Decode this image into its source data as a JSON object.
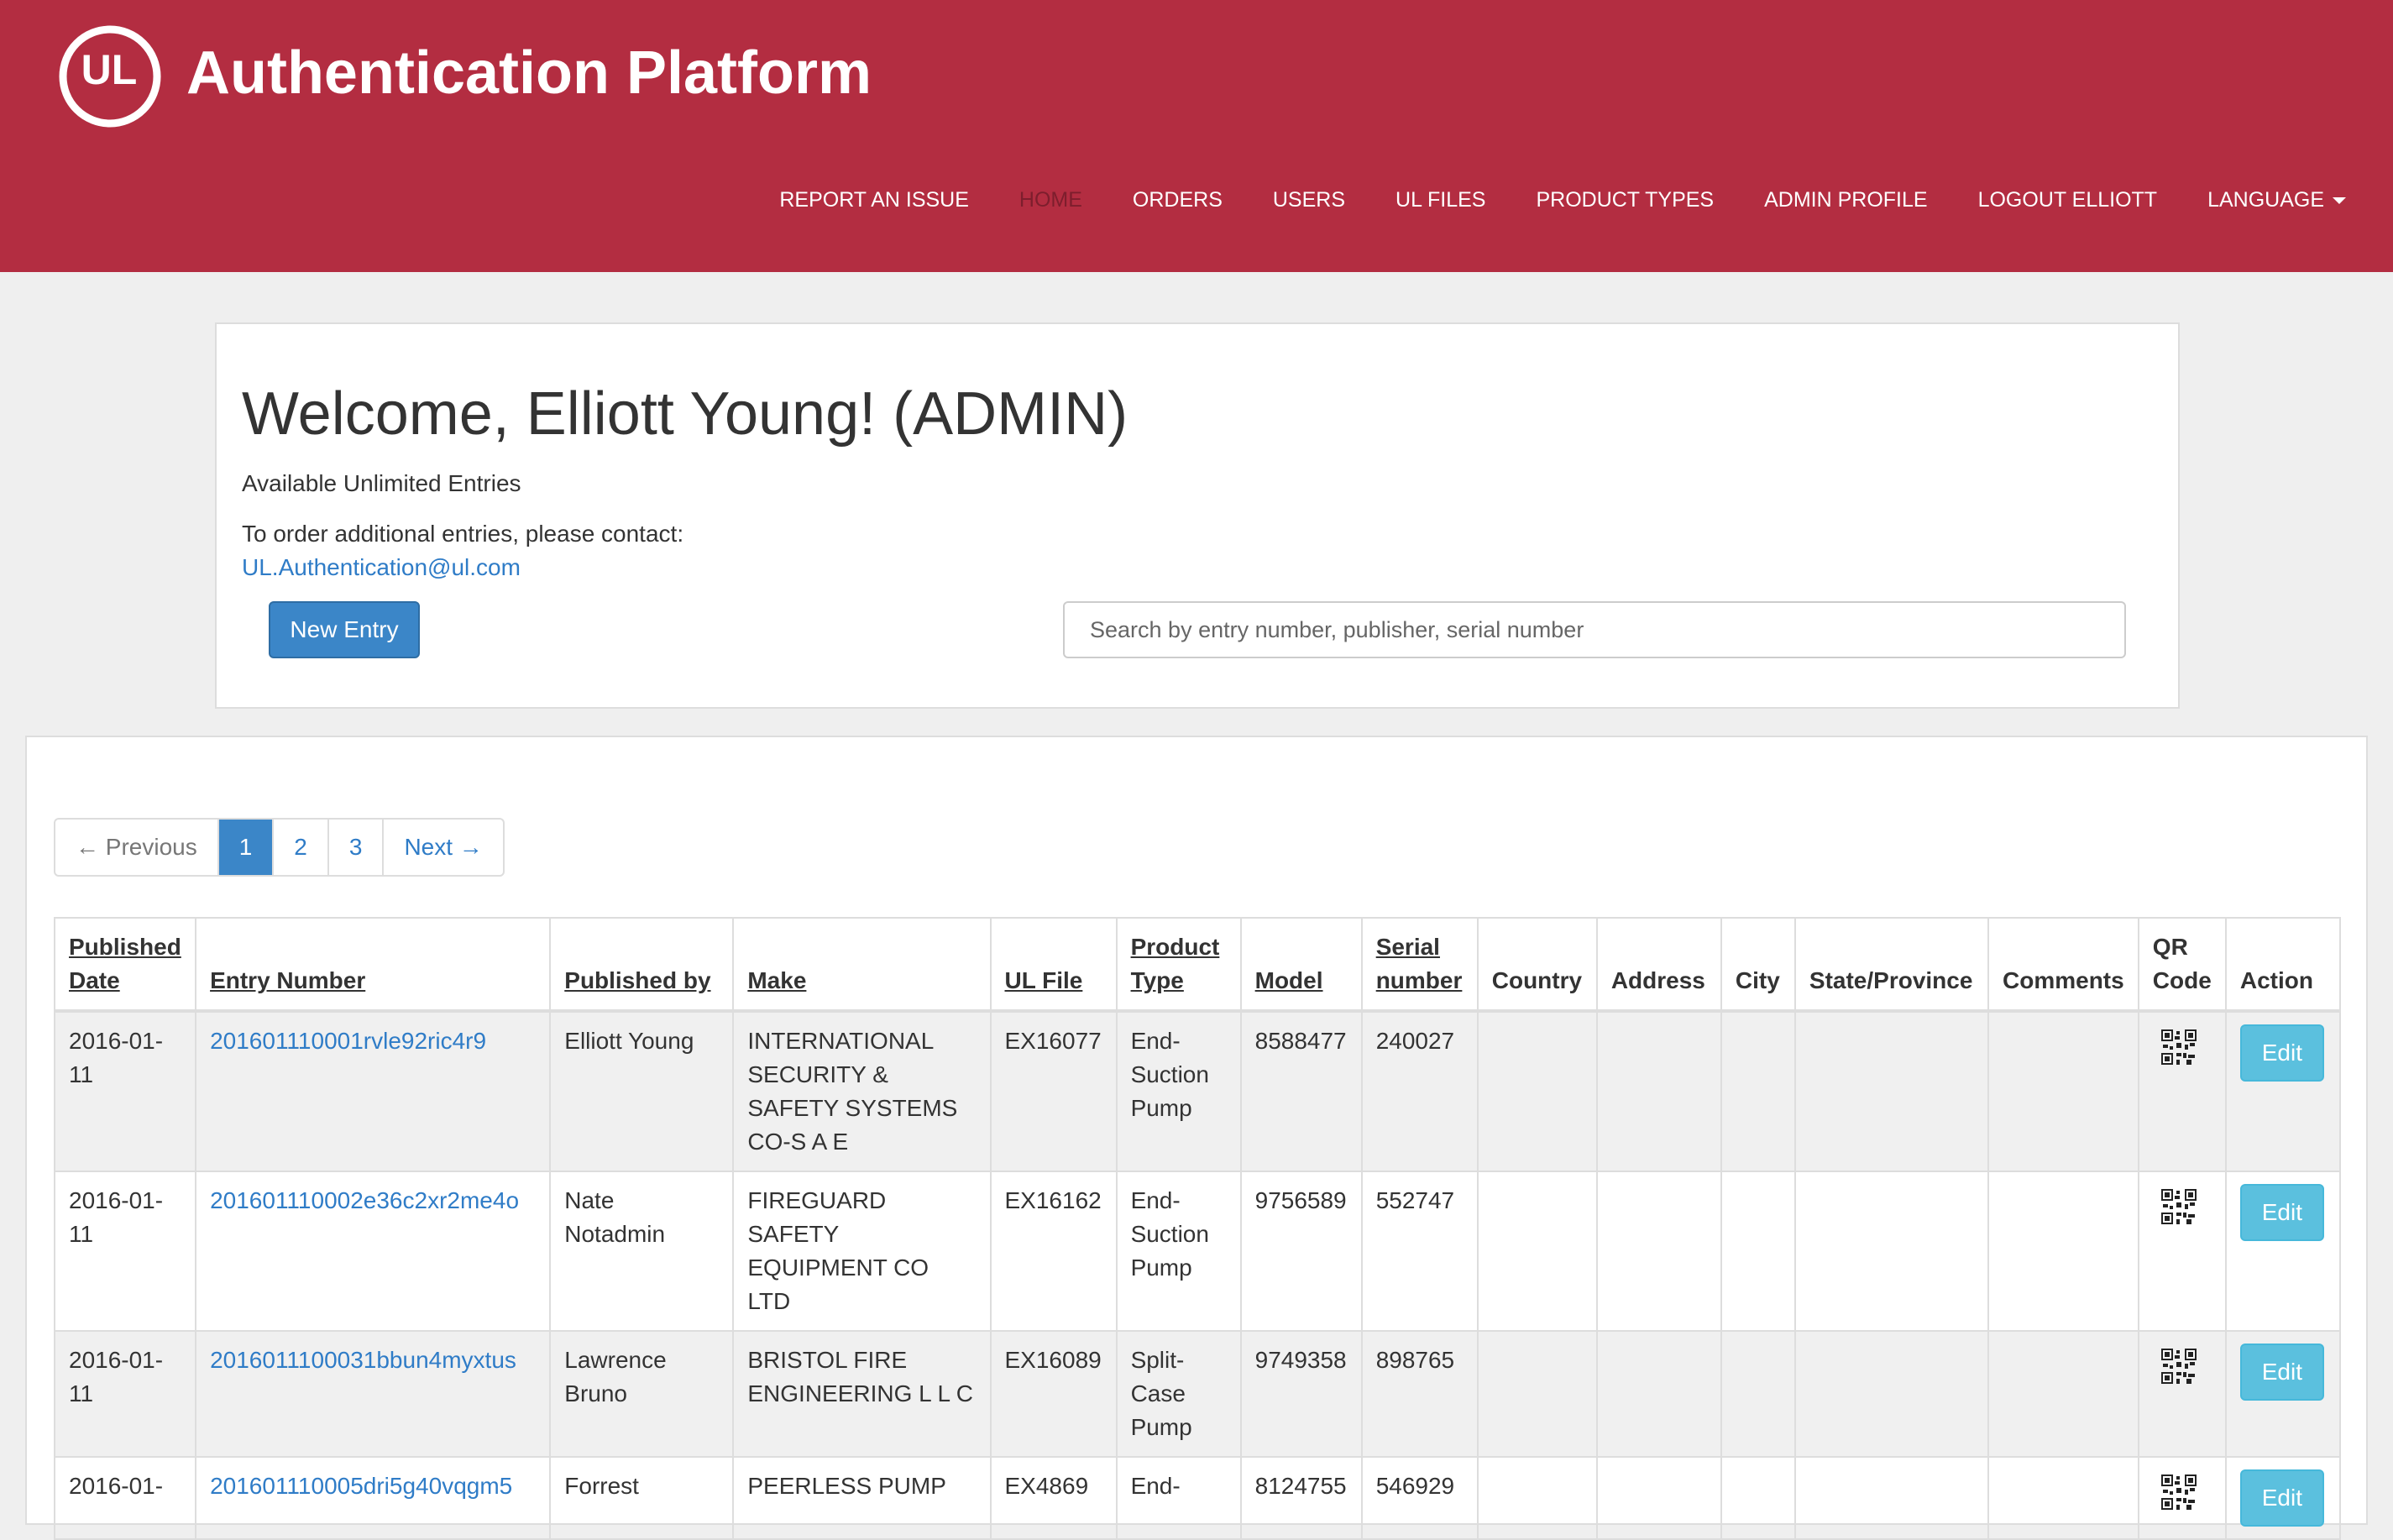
{
  "header": {
    "logo_text": "UL",
    "title": "Authentication Platform",
    "nav": [
      {
        "label": "REPORT AN ISSUE",
        "active": false
      },
      {
        "label": "HOME",
        "active": true
      },
      {
        "label": "ORDERS",
        "active": false
      },
      {
        "label": "USERS",
        "active": false
      },
      {
        "label": "UL FILES",
        "active": false
      },
      {
        "label": "PRODUCT TYPES",
        "active": false
      },
      {
        "label": "ADMIN PROFILE",
        "active": false
      },
      {
        "label": "LOGOUT ELLIOTT",
        "active": false
      },
      {
        "label": "LANGUAGE",
        "active": false,
        "dropdown": true
      }
    ]
  },
  "welcome": {
    "heading": "Welcome, Elliott Young! (ADMIN)",
    "available": "Available Unlimited Entries",
    "contact_text": "To order additional entries, please contact:",
    "contact_email": "UL.Authentication@ul.com",
    "new_entry_label": "New Entry",
    "search_placeholder": "Search by entry number, publisher, serial number"
  },
  "pagination": {
    "previous": "← Previous",
    "pages": [
      "1",
      "2",
      "3"
    ],
    "current": "1",
    "next": "Next →"
  },
  "table": {
    "columns": [
      "Published Date",
      "Entry Number",
      "Published by",
      "Make",
      "UL File",
      "Product Type",
      "Model",
      "Serial number",
      "Country",
      "Address",
      "City",
      "State/Province",
      "Comments",
      "QR Code",
      "Action"
    ],
    "sortable": [
      true,
      true,
      true,
      true,
      true,
      true,
      true,
      true,
      false,
      false,
      false,
      false,
      false,
      false,
      false
    ],
    "edit_label": "Edit",
    "rows": [
      {
        "published_date": "2016-01-11",
        "entry_number": "201601110001rvle92ric4r9",
        "published_by": "Elliott Young",
        "make": "INTERNATIONAL SECURITY & SAFETY SYSTEMS CO-S A E",
        "ul_file": "EX16077",
        "product_type": "End-Suction Pump",
        "model": "8588477",
        "serial_number": "240027",
        "country": "",
        "address": "",
        "city": "",
        "state": "",
        "comments": ""
      },
      {
        "published_date": "2016-01-11",
        "entry_number": "201601110002e36c2xr2me4o",
        "published_by": "Nate Notadmin",
        "make": "FIREGUARD SAFETY EQUIPMENT CO LTD",
        "ul_file": "EX16162",
        "product_type": "End-Suction Pump",
        "model": "9756589",
        "serial_number": "552747",
        "country": "",
        "address": "",
        "city": "",
        "state": "",
        "comments": ""
      },
      {
        "published_date": "2016-01-11",
        "entry_number": "2016011100031bbun4myxtus",
        "published_by": "Lawrence Bruno",
        "make": "BRISTOL FIRE ENGINEERING L L C",
        "ul_file": "EX16089",
        "product_type": "Split-Case Pump",
        "model": "9749358",
        "serial_number": "898765",
        "country": "",
        "address": "",
        "city": "",
        "state": "",
        "comments": ""
      },
      {
        "published_date": "2016-01-",
        "entry_number": "201601110005dri5g40vqgm5",
        "published_by": "Forrest",
        "make": "PEERLESS PUMP",
        "ul_file": "EX4869",
        "product_type": "End-",
        "model": "8124755",
        "serial_number": "546929",
        "country": "",
        "address": "",
        "city": "",
        "state": "",
        "comments": ""
      }
    ]
  },
  "colors": {
    "header_bg": "#b32d41",
    "primary": "#3b86c8",
    "info": "#5bc0de",
    "link": "#2f7cc7"
  }
}
